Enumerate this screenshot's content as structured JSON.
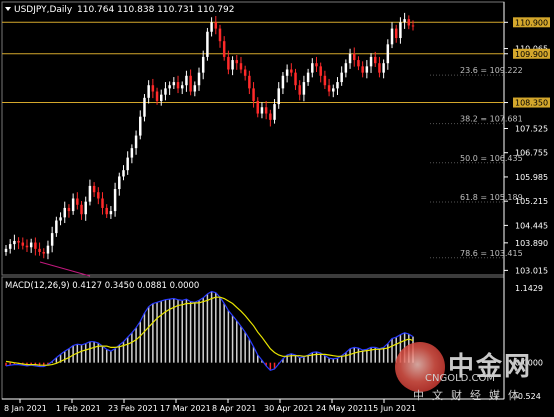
{
  "header": {
    "symbol": "USDJPY,Daily",
    "ohlc": "110.764 110.838 110.731 110.792",
    "macd_label": "MACD(12,26,9) 0.4127 0.3450 0.0881 0.0000"
  },
  "colors": {
    "background": "#000000",
    "bull": "#ffffff",
    "bear": "#ff2a2a",
    "level_line": "#d4a72c",
    "macd_line": "#2a3cff",
    "signal_line": "#e8e400",
    "fib_text": "#bfbfbf",
    "axis": "#ffffff"
  },
  "price_axis": {
    "ticks": [
      "110.900",
      "110.065",
      "109.900",
      "108.350",
      "107.525",
      "106.755",
      "105.985",
      "105.215",
      "104.445",
      "103.890",
      "103.015"
    ],
    "highlight": [
      "110.900",
      "109.900",
      "108.350"
    ]
  },
  "macd_axis": {
    "ticks": [
      "1.1429",
      "0.0000",
      "-0.524"
    ]
  },
  "time_axis": {
    "ticks": [
      "8 Jan 2021",
      "1 Feb 2021",
      "23 Feb 2021",
      "17 Mar 2021",
      "8 Apr 2021",
      "30 Apr 2021",
      "24 May 2021",
      "15 Jun 2021"
    ]
  },
  "levels": {
    "horizontal": [
      110.9,
      109.9,
      108.35
    ],
    "fib": [
      {
        "label": "23.6 = 109.222",
        "value": 109.222
      },
      {
        "label": "38.2 = 107.681",
        "value": 107.681
      },
      {
        "label": "50.0 = 106.435",
        "value": 106.435
      },
      {
        "label": "61.8 = 105.189",
        "value": 105.189
      },
      {
        "label": "78.6 = 103.415",
        "value": 103.415
      }
    ]
  },
  "chart_data": {
    "type": "candlestick",
    "title": "USDJPY,Daily",
    "ylim": [
      102.9,
      111.45
    ],
    "closes": [
      103.7,
      103.85,
      103.95,
      103.9,
      103.8,
      103.75,
      103.9,
      103.7,
      103.6,
      103.55,
      103.8,
      104.2,
      104.6,
      104.7,
      105.0,
      104.9,
      105.3,
      105.1,
      104.8,
      105.2,
      105.7,
      105.5,
      105.3,
      105.0,
      104.8,
      104.9,
      105.6,
      106.0,
      106.2,
      106.6,
      106.9,
      107.3,
      107.9,
      108.5,
      108.9,
      108.7,
      108.4,
      108.6,
      108.8,
      108.9,
      109.0,
      108.8,
      108.9,
      109.2,
      108.7,
      108.9,
      109.3,
      109.8,
      110.6,
      110.9,
      110.7,
      110.3,
      109.8,
      109.4,
      109.7,
      109.6,
      109.4,
      109.2,
      108.8,
      108.4,
      108.0,
      108.2,
      108.0,
      107.8,
      108.3,
      108.8,
      109.2,
      109.4,
      109.3,
      108.9,
      108.6,
      109.0,
      109.3,
      109.6,
      109.5,
      109.2,
      108.9,
      108.7,
      108.8,
      109.0,
      109.3,
      109.6,
      109.9,
      109.7,
      109.5,
      109.3,
      109.5,
      109.8,
      109.6,
      109.3,
      109.6,
      110.2,
      110.7,
      110.4,
      110.9,
      111.0,
      110.8,
      110.79
    ],
    "macd": [
      -0.05,
      -0.04,
      -0.03,
      -0.03,
      -0.04,
      -0.05,
      -0.04,
      -0.05,
      -0.06,
      -0.06,
      -0.03,
      0.02,
      0.08,
      0.13,
      0.18,
      0.22,
      0.27,
      0.29,
      0.28,
      0.3,
      0.33,
      0.33,
      0.31,
      0.26,
      0.21,
      0.18,
      0.22,
      0.28,
      0.33,
      0.4,
      0.47,
      0.55,
      0.65,
      0.78,
      0.88,
      0.93,
      0.95,
      0.97,
      0.99,
      1.0,
      1.01,
      0.99,
      0.98,
      1.0,
      0.96,
      0.95,
      0.98,
      1.02,
      1.08,
      1.12,
      1.1,
      1.03,
      0.93,
      0.82,
      0.74,
      0.66,
      0.57,
      0.48,
      0.37,
      0.25,
      0.12,
      0.04,
      -0.05,
      -0.12,
      -0.1,
      -0.02,
      0.06,
      0.12,
      0.14,
      0.12,
      0.08,
      0.09,
      0.12,
      0.16,
      0.17,
      0.15,
      0.11,
      0.07,
      0.06,
      0.07,
      0.11,
      0.16,
      0.22,
      0.24,
      0.23,
      0.2,
      0.21,
      0.24,
      0.24,
      0.22,
      0.24,
      0.3,
      0.38,
      0.4,
      0.44,
      0.47,
      0.45,
      0.41
    ],
    "signal": [
      0.02,
      0.01,
      0.0,
      -0.01,
      -0.02,
      -0.03,
      -0.03,
      -0.03,
      -0.04,
      -0.04,
      -0.04,
      -0.03,
      -0.01,
      0.02,
      0.05,
      0.08,
      0.12,
      0.15,
      0.18,
      0.2,
      0.22,
      0.24,
      0.26,
      0.26,
      0.26,
      0.24,
      0.24,
      0.25,
      0.27,
      0.29,
      0.32,
      0.36,
      0.42,
      0.49,
      0.56,
      0.63,
      0.7,
      0.75,
      0.8,
      0.84,
      0.87,
      0.9,
      0.91,
      0.93,
      0.93,
      0.94,
      0.94,
      0.96,
      0.98,
      1.01,
      1.03,
      1.03,
      1.01,
      0.97,
      0.93,
      0.87,
      0.81,
      0.74,
      0.66,
      0.58,
      0.48,
      0.4,
      0.31,
      0.22,
      0.16,
      0.12,
      0.1,
      0.1,
      0.11,
      0.11,
      0.11,
      0.1,
      0.11,
      0.12,
      0.13,
      0.13,
      0.13,
      0.12,
      0.11,
      0.1,
      0.1,
      0.11,
      0.13,
      0.15,
      0.17,
      0.18,
      0.19,
      0.2,
      0.21,
      0.21,
      0.22,
      0.23,
      0.26,
      0.29,
      0.32,
      0.35,
      0.37,
      0.35
    ],
    "macd_ylim": [
      -0.524,
      1.1429
    ]
  },
  "watermark": {
    "name": "中金网",
    "site": "CNGOLD.COM",
    "sub": "中文财经媒体"
  }
}
